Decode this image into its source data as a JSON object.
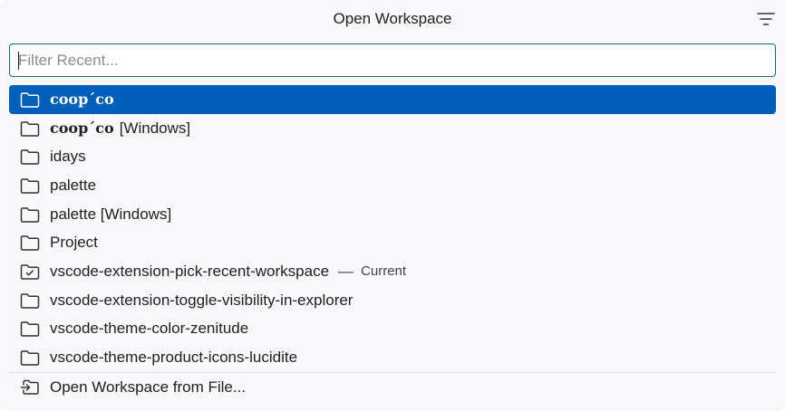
{
  "header": {
    "title": "Open Workspace",
    "filter_icon": "filter-lines-icon"
  },
  "search": {
    "placeholder": "Filter Recent...",
    "value": ""
  },
  "items": [
    {
      "label": "coop´co",
      "suffix": "",
      "icon": "folder-icon",
      "selected": true,
      "styled": true
    },
    {
      "label": "coop´co",
      "suffix": "[Windows]",
      "icon": "folder-icon",
      "selected": false,
      "styled": true
    },
    {
      "label": "idays",
      "suffix": "",
      "icon": "folder-icon"
    },
    {
      "label": "palette",
      "suffix": "",
      "icon": "folder-icon"
    },
    {
      "label": "palette [Windows]",
      "suffix": "",
      "icon": "folder-icon"
    },
    {
      "label": "Project",
      "suffix": "",
      "icon": "folder-icon"
    },
    {
      "label": "vscode-extension-pick-recent-workspace",
      "separator": "—",
      "description": "Current",
      "icon": "folder-active-icon"
    },
    {
      "label": "vscode-extension-toggle-visibility-in-explorer",
      "icon": "folder-icon"
    },
    {
      "label": "vscode-theme-color-zenitude",
      "icon": "folder-icon"
    },
    {
      "label": "vscode-theme-product-icons-lucidite",
      "icon": "folder-icon"
    }
  ],
  "action": {
    "label": "Open Workspace from File...",
    "icon": "open-file-icon"
  },
  "colors": {
    "selection": "#005fb8",
    "focus_border": "#0a6e8c",
    "background": "#f8f8fa"
  }
}
